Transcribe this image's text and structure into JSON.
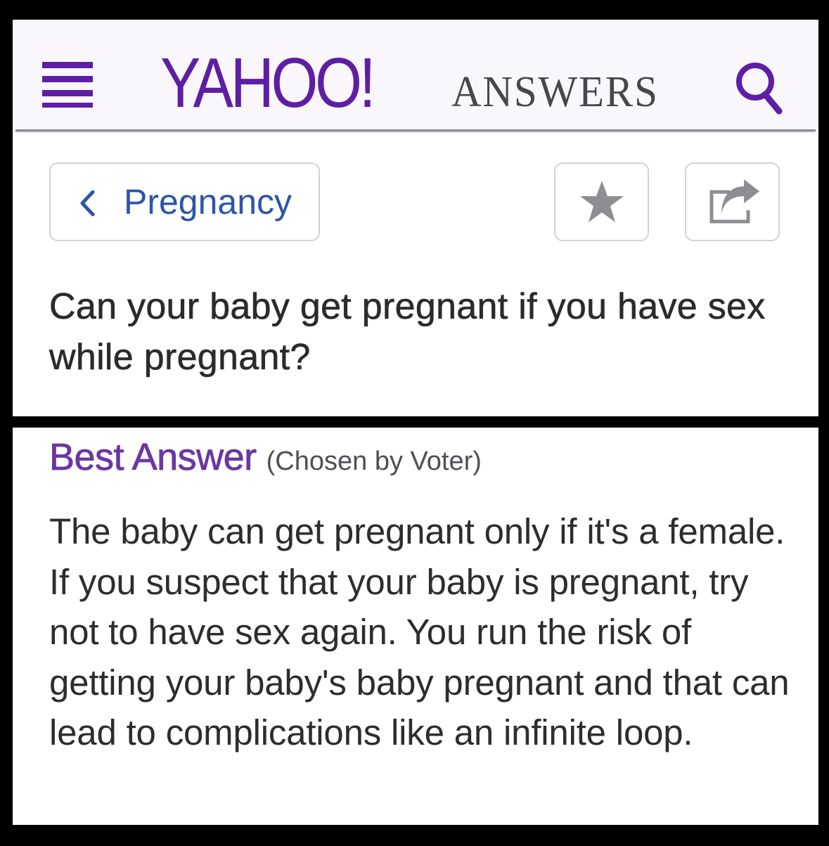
{
  "header": {
    "logo": "YAHOO!",
    "product": "ANSWERS",
    "menu_icon": "hamburger-menu-icon",
    "search_icon": "search-icon",
    "brand_color": "#5e1ea4"
  },
  "toolbar": {
    "back_label": "Pregnancy",
    "back_icon": "chevron-left-icon",
    "star_icon": "star-icon",
    "share_icon": "share-icon"
  },
  "question": {
    "title": "Can your baby get pregnant if you have sex while pregnant?"
  },
  "best_answer": {
    "heading": "Best Answer",
    "chosen_by": "(Chosen by Voter)",
    "accent_color": "#6b37a3",
    "text": "The baby can get pregnant only if it's a female. If you suspect that your baby is pregnant, try not to have sex again. You run the risk of getting your baby's baby pregnant and that can lead to complications like an infinite loop."
  }
}
